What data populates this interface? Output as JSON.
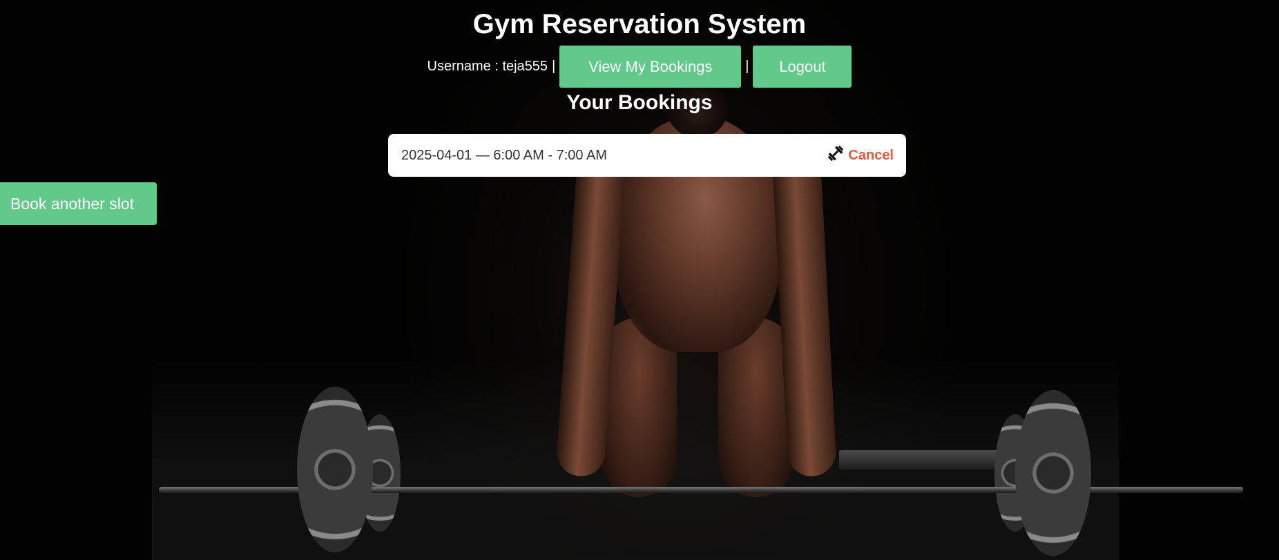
{
  "header": {
    "title": "Gym Reservation System"
  },
  "userbar": {
    "username_text": "Username : teja555",
    "separator": "|",
    "view_bookings_label": "View My Bookings",
    "logout_label": "Logout"
  },
  "bookings": {
    "heading": "Your Bookings",
    "items": [
      {
        "slot": "2025-04-01 — 6:00 AM - 7:00 AM",
        "action_label": "Cancel",
        "icon": "dumbbell-icon"
      }
    ]
  },
  "actions": {
    "book_another_label": "Book another slot"
  },
  "colors": {
    "accent_green": "#63c98a",
    "cancel_red": "#e05a44",
    "background": "#000000"
  }
}
